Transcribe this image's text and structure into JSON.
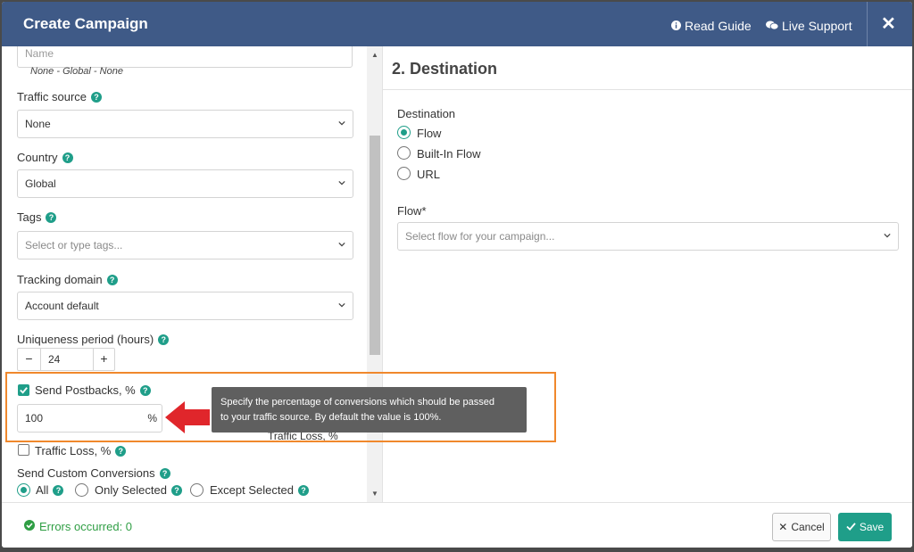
{
  "header": {
    "title": "Create Campaign",
    "read_guide": "Read Guide",
    "live_support": "Live Support"
  },
  "left": {
    "name_placeholder": "Name",
    "name_hint": "None - Global - None",
    "traffic_source": {
      "label": "Traffic source",
      "value": "None"
    },
    "country": {
      "label": "Country",
      "value": "Global"
    },
    "tags": {
      "label": "Tags",
      "placeholder": "Select or type tags..."
    },
    "tracking_domain": {
      "label": "Tracking domain",
      "value": "Account default"
    },
    "uniqueness": {
      "label": "Uniqueness period (hours)",
      "value": "24",
      "minus": "−",
      "plus": "+"
    },
    "send_postbacks": {
      "label": "Send Postbacks, %",
      "value": "100",
      "unit": "%"
    },
    "traffic_loss": {
      "label": "Traffic Loss, %",
      "ghost": "Traffic Loss, %"
    },
    "custom_conversions": {
      "label": "Send Custom Conversions",
      "options": [
        "All",
        "Only Selected",
        "Except Selected"
      ]
    }
  },
  "tooltip": {
    "line1": "Specify the percentage of conversions which should be passed",
    "line2": "to your traffic source. By default the value is 100%."
  },
  "right": {
    "section_title": "2. Destination",
    "destination_label": "Destination",
    "destination_options": [
      "Flow",
      "Built-In Flow",
      "URL"
    ],
    "flow_label": "Flow*",
    "flow_placeholder": "Select flow for your campaign..."
  },
  "footer": {
    "errors": "Errors occurred: 0",
    "cancel": "Cancel",
    "save": "Save"
  },
  "colors": {
    "header_bg": "#3f5a87",
    "accent": "#1f9e89",
    "highlight": "#f0882c",
    "arrow": "#e0262b"
  }
}
